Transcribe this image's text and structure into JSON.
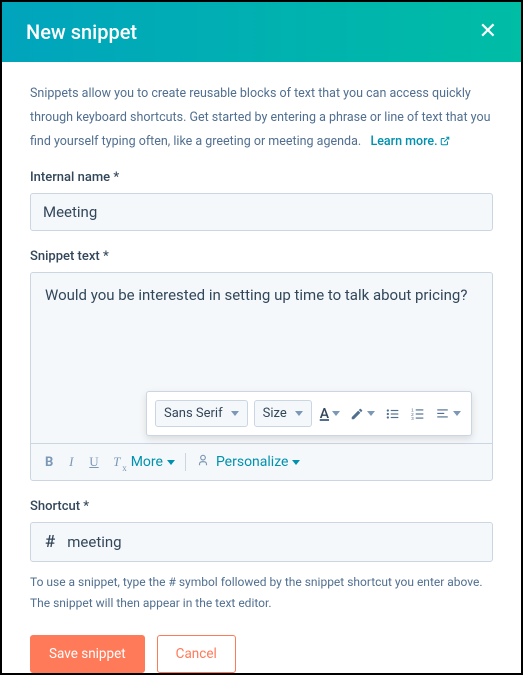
{
  "header": {
    "title": "New snippet"
  },
  "description": {
    "text": "Snippets allow you to create reusable blocks of text that you can access quickly through keyboard shortcuts. Get started by entering a phrase or line of text that you find yourself typing often, like a greeting or meeting agenda.",
    "learn_more": "Learn more."
  },
  "internal_name": {
    "label": "Internal name *",
    "value": "Meeting"
  },
  "snippet_text": {
    "label": "Snippet text *",
    "value": "Would you be interested in setting up time to talk about pricing?"
  },
  "toolbar": {
    "more": "More",
    "personalize": "Personalize"
  },
  "popup": {
    "font_family": "Sans Serif",
    "font_size": "Size"
  },
  "shortcut": {
    "label": "Shortcut *",
    "prefix": "#",
    "value": "meeting",
    "help": "To use a snippet, type the # symbol followed by the snippet shortcut you enter above. The snippet will then appear in the text editor."
  },
  "footer": {
    "save": "Save snippet",
    "cancel": "Cancel"
  }
}
